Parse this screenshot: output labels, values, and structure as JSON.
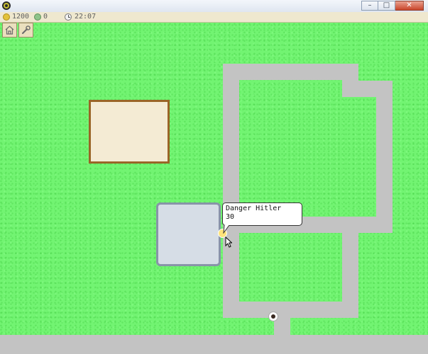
{
  "window": {
    "app_icon": "gear-icon",
    "buttons": {
      "minimize": "–",
      "maximize": "□",
      "close": "✕"
    }
  },
  "hud": {
    "money": "1200",
    "money_icon": "coin-icon",
    "population": "0",
    "population_icon": "population-icon",
    "time": "22:07",
    "time_icon": "clock-icon"
  },
  "toolbar": {
    "tools": [
      {
        "name": "build-house-tool",
        "icon": "house-icon"
      },
      {
        "name": "repair-tool",
        "icon": "wrench-icon"
      }
    ]
  },
  "tooltip": {
    "name": "Danger Hitler",
    "value": "30"
  },
  "colors": {
    "grass": "#72f472",
    "road": "#c3c3c3",
    "building_fill": "#f4ebd4",
    "building_border": "#9a6527",
    "pool_fill": "#d6dde6",
    "pool_border": "#8894a8",
    "hud_background": "#efe8cf"
  }
}
